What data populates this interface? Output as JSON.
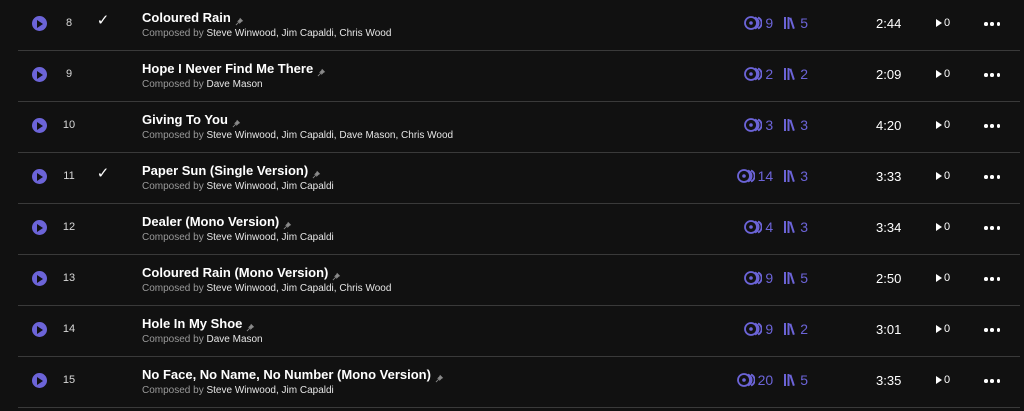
{
  "colors": {
    "background": "#111111",
    "accent": "#6c64d8",
    "divider": "#3a3a3a",
    "muted_text": "#9a9a9a"
  },
  "composed_by_label": "Composed by",
  "tracks": [
    {
      "number": "8",
      "selected": true,
      "title": "Coloured Rain",
      "composers": [
        "Steve Winwood",
        "Jim Capaldi",
        "Chris Wood"
      ],
      "recordings": "9",
      "releases": "5",
      "duration": "2:44",
      "plays": "0"
    },
    {
      "number": "9",
      "selected": false,
      "title": "Hope I Never Find Me There",
      "composers": [
        "Dave Mason"
      ],
      "recordings": "2",
      "releases": "2",
      "duration": "2:09",
      "plays": "0"
    },
    {
      "number": "10",
      "selected": false,
      "title": "Giving To You",
      "composers": [
        "Steve Winwood",
        "Jim Capaldi",
        "Dave Mason",
        "Chris Wood"
      ],
      "recordings": "3",
      "releases": "3",
      "duration": "4:20",
      "plays": "0"
    },
    {
      "number": "11",
      "selected": true,
      "title": "Paper Sun (Single Version)",
      "composers": [
        "Steve Winwood",
        "Jim Capaldi"
      ],
      "recordings": "14",
      "releases": "3",
      "duration": "3:33",
      "plays": "0"
    },
    {
      "number": "12",
      "selected": false,
      "title": "Dealer (Mono Version)",
      "composers": [
        "Steve Winwood",
        "Jim Capaldi"
      ],
      "recordings": "4",
      "releases": "3",
      "duration": "3:34",
      "plays": "0"
    },
    {
      "number": "13",
      "selected": false,
      "title": "Coloured Rain (Mono Version)",
      "composers": [
        "Steve Winwood",
        "Jim Capaldi",
        "Chris Wood"
      ],
      "recordings": "9",
      "releases": "5",
      "duration": "2:50",
      "plays": "0"
    },
    {
      "number": "14",
      "selected": false,
      "title": "Hole In My Shoe",
      "composers": [
        "Dave Mason"
      ],
      "recordings": "9",
      "releases": "2",
      "duration": "3:01",
      "plays": "0"
    },
    {
      "number": "15",
      "selected": false,
      "title": "No Face, No Name, No Number (Mono Version)",
      "composers": [
        "Steve Winwood",
        "Jim Capaldi"
      ],
      "recordings": "20",
      "releases": "5",
      "duration": "3:35",
      "plays": "0"
    }
  ],
  "icons": {
    "play": "play-circle-icon",
    "selected": "checkmark-icon",
    "pin": "pin-icon",
    "recordings": "recordings-icon",
    "releases": "releases-icon",
    "plays": "play-count-icon",
    "more": "more-options-icon"
  }
}
